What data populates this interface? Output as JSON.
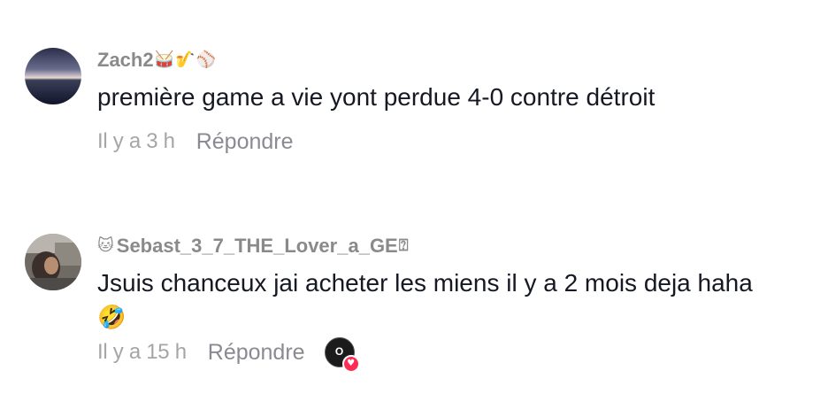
{
  "comments": [
    {
      "username": "Zach2",
      "username_emojis": [
        "🥁",
        "🎷",
        "⚾"
      ],
      "text": "première game a vie yont perdue 4-0 contre détroit",
      "time": "Il y a 3 h",
      "reply_label": "Répondre"
    },
    {
      "username_prefix_emoji": "🐱",
      "username": "Sebast_3_7_THE_Lover_a_GE",
      "username_suffix": "⍰",
      "text": "Jsuis chanceux jai acheter les miens il y a 2 mois deja haha",
      "text_emoji": "🤣",
      "time": "Il y a 15 h",
      "reply_label": "Répondre",
      "liked_by_creator_badge": "O",
      "liked_by_heart": "♥"
    }
  ],
  "colors": {
    "username": "#8a8a8a",
    "text": "#161823",
    "meta": "#a5a5a8",
    "heart": "#fe2c55"
  }
}
